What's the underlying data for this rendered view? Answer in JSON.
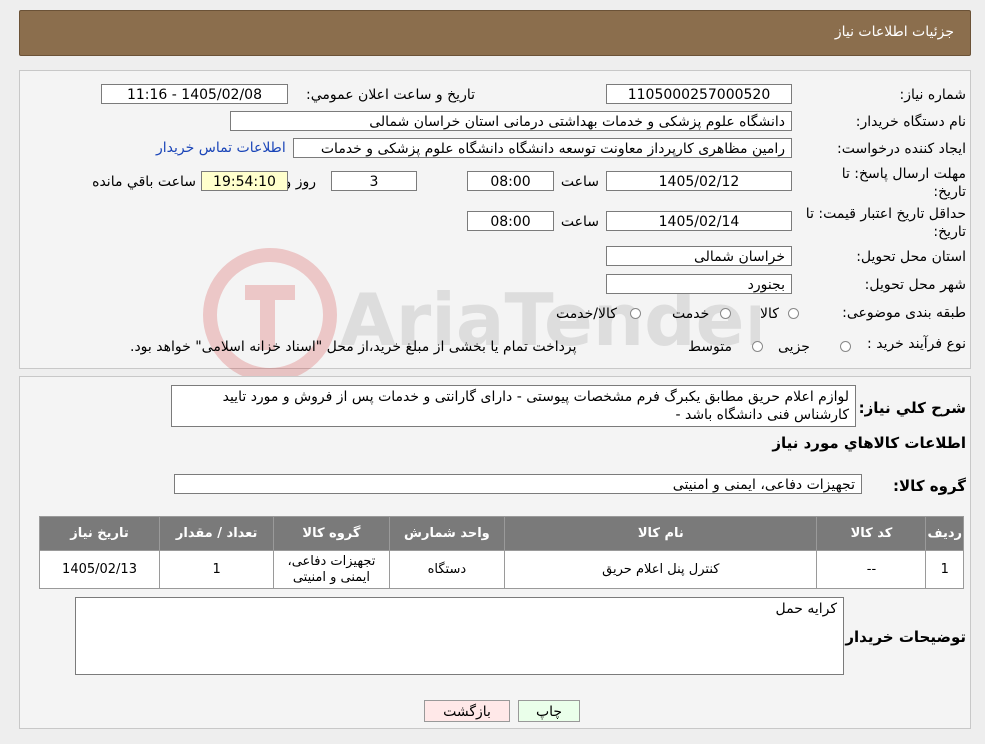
{
  "header": {
    "title": "جزئیات اطلاعات نیاز"
  },
  "need": {
    "number_label": "شماره نیاز:",
    "number": "1105000257000520",
    "announce_label": "تاریخ و ساعت اعلان عمومي:",
    "announce": "1405/02/08 - 11:16",
    "buyer_label": "نام دستگاه خريدار:",
    "buyer": "دانشگاه علوم پزشکی و خدمات بهداشتی درمانی استان خراسان شمالی",
    "creator_label": "ایجاد کننده درخواست:",
    "creator": "رامین مظاهری کارپرداز معاونت توسعه دانشگاه دانشگاه علوم پزشکی و خدمات",
    "contact_link": "اطلاعات تماس خریدار",
    "deadline_label": "مهلت ارسال پاسخ: تا تاریخ:",
    "deadline_date": "1405/02/12",
    "time_label": "ساعت",
    "deadline_time": "08:00",
    "days": "3",
    "days_label": "روز و",
    "remaining": "19:54:10",
    "remaining_label": "ساعت باقي مانده",
    "validity_label": "حداقل تاریخ اعتبار قیمت: تا تاریخ:",
    "validity_date": "1405/02/14",
    "validity_time": "08:00",
    "province_label": "استان محل تحویل:",
    "province": "خراسان شمالی",
    "city_label": "شهر محل تحویل:",
    "city": "بجنورد",
    "category_label": "طبقه بندی موضوعی:",
    "cat_options": [
      "کالا",
      "خدمت",
      "کالا/خدمت"
    ],
    "process_label": "نوع فرآیند خرید :",
    "process_options": [
      "جزیی",
      "متوسط"
    ],
    "process_note": "پرداخت تمام یا بخشی از مبلغ خرید،از محل \"اسناد خزانه اسلامی\" خواهد بود."
  },
  "description": {
    "label": "شرح کلي نياز:",
    "text": "لوازم اعلام حریق مطابق یکبرگ فرم مشخصات پیوستی - دارای گارانتی و خدمات پس از فروش و مورد تایید کارشناس فنی دانشگاه باشد -"
  },
  "goods": {
    "section_title": "اطلاعات کالاهاي مورد نياز",
    "group_label": "گروه کالا:",
    "group": "تجهیزات دفاعی، ایمنی و امنیتی",
    "columns": [
      "رديف",
      "کد کالا",
      "نام کالا",
      "واحد شمارش",
      "گروه کالا",
      "تعداد / مقدار",
      "تاريخ نياز"
    ],
    "rows": [
      {
        "row": "1",
        "code": "--",
        "name": "کنترل پنل اعلام حریق",
        "unit": "دستگاه",
        "group": "تجهیزات دفاعی، ایمنی و امنیتی",
        "qty": "1",
        "date": "1405/02/13"
      }
    ]
  },
  "buyer_notes": {
    "label": "توضیحات خریدار:",
    "text": "کرایه حمل"
  },
  "buttons": {
    "print": "چاپ",
    "back": "بازگشت"
  },
  "watermark": {
    "text": "AriaTender.neT"
  }
}
